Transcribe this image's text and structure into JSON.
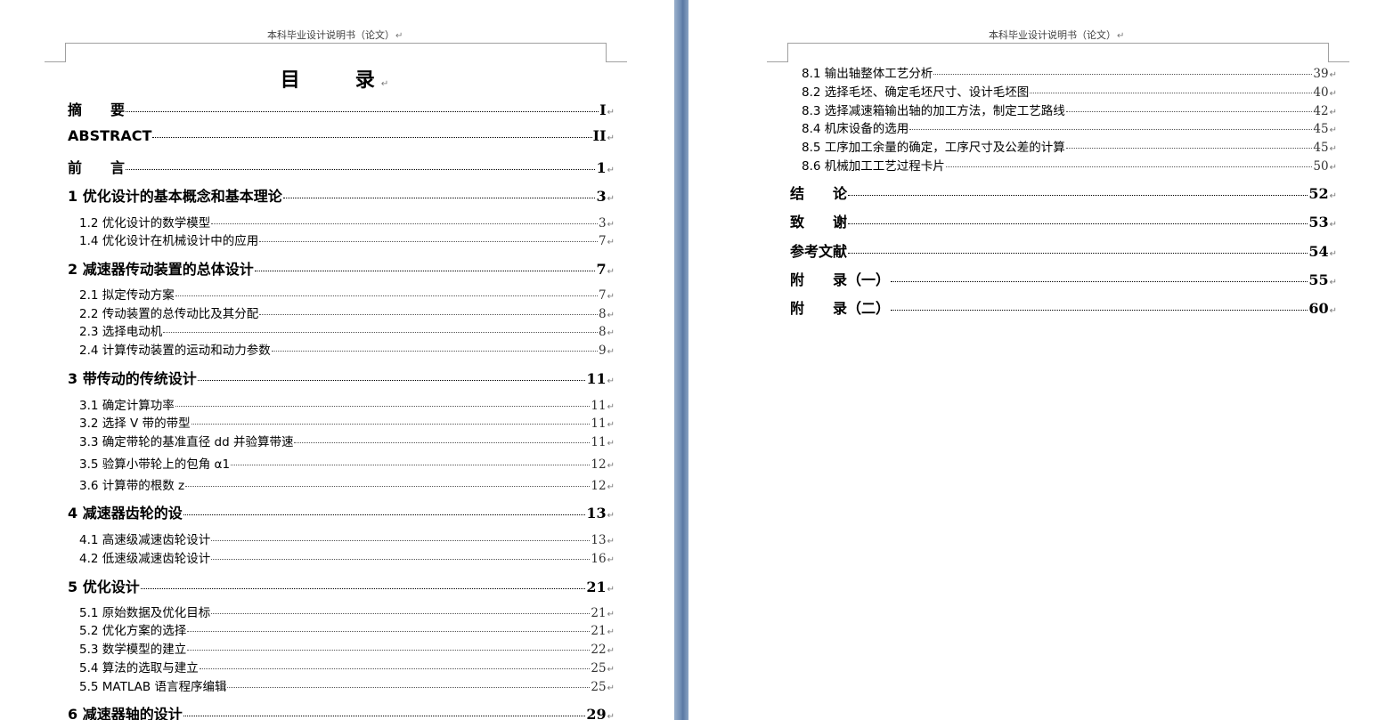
{
  "header": "本科毕业设计说明书（论文）",
  "toc_title": "目　　录",
  "paragraph_mark": "↵",
  "left_entries": [
    {
      "label": "摘　　要",
      "page": "I",
      "level": 1
    },
    {
      "label": "ABSTRACT",
      "page": "II",
      "level": 1
    },
    {
      "label": "前　　言",
      "page": "1",
      "level": 1
    },
    {
      "label": "1 优化设计的基本概念和基本理论",
      "page": "3",
      "level": 1
    },
    {
      "label": "1.2 优化设计的数学模型",
      "page": "3",
      "level": 2
    },
    {
      "label": "1.4 优化设计在机械设计中的应用",
      "page": "7",
      "level": 2
    },
    {
      "label": "2 减速器传动装置的总体设计",
      "page": "7",
      "level": 1
    },
    {
      "label": "2.1 拟定传动方案",
      "page": "7",
      "level": 2
    },
    {
      "label": "2.2 传动装置的总传动比及其分配",
      "page": "8",
      "level": 2
    },
    {
      "label": "2.3 选择电动机",
      "page": "8",
      "level": 2
    },
    {
      "label": "2.4 计算传动装置的运动和动力参数",
      "page": "9",
      "level": 2
    },
    {
      "label": "3 带传动的传统设计",
      "page": "11",
      "level": 1
    },
    {
      "label": "3.1 确定计算功率",
      "page": "11",
      "level": 2
    },
    {
      "label": "3.2 选择 V 带的带型",
      "page": "11",
      "level": 2
    },
    {
      "label": "3.3 确定带轮的基准直径 dd 并验算带速",
      "page": "11",
      "level": 2
    },
    {
      "label": "3.5 验算小带轮上的包角 α1",
      "page": "12",
      "level": 2
    },
    {
      "label": "3.6 计算带的根数 z",
      "page": "12",
      "level": 2
    },
    {
      "label": "4 减速器齿轮的设",
      "page": "13",
      "level": 1
    },
    {
      "label": "4.1 高速级减速齿轮设计",
      "page": "13",
      "level": 2
    },
    {
      "label": "4.2 低速级减速齿轮设计",
      "page": "16",
      "level": 2
    },
    {
      "label": "5 优化设计",
      "page": "21",
      "level": 1
    },
    {
      "label": "5.1 原始数据及优化目标",
      "page": "21",
      "level": 2
    },
    {
      "label": "5.2 优化方案的选择",
      "page": "21",
      "level": 2
    },
    {
      "label": "5.3 数学模型的建立",
      "page": "22",
      "level": 2
    },
    {
      "label": "5.4 算法的选取与建立",
      "page": "25",
      "level": 2
    },
    {
      "label": "5.5 MATLAB 语言程序编辑",
      "page": "25",
      "level": 2
    },
    {
      "label": "6 减速器轴的设计",
      "page": "29",
      "level": 1
    }
  ],
  "right_entries": [
    {
      "label": "8.1 输出轴整体工艺分析",
      "page": "39",
      "level": 2
    },
    {
      "label": "8.2 选择毛坯、确定毛坯尺寸、设计毛坯图",
      "page": "40",
      "level": 2
    },
    {
      "label": "8.3 选择减速箱输出轴的加工方法，制定工艺路线",
      "page": "42",
      "level": 2
    },
    {
      "label": "8.4 机床设备的选用",
      "page": "45",
      "level": 2
    },
    {
      "label": "8.5 工序加工余量的确定，工序尺寸及公差的计算",
      "page": "45",
      "level": 2
    },
    {
      "label": "8.6 机械加工工艺过程卡片",
      "page": "50",
      "level": 2
    },
    {
      "label": "结　　论",
      "page": "52",
      "level": 1
    },
    {
      "label": "致　　谢",
      "page": "53",
      "level": 1
    },
    {
      "label": "参考文献",
      "page": "54",
      "level": 1
    },
    {
      "label": "附　　录（一）",
      "page": "55",
      "level": 1
    },
    {
      "label": "附　　录（二）",
      "page": "60",
      "level": 1
    }
  ]
}
